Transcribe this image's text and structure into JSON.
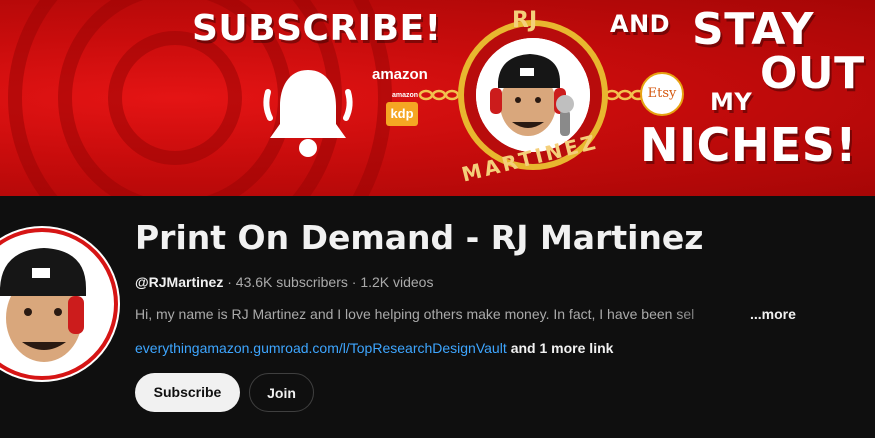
{
  "banner": {
    "headline_left": "SUBSCRIBE!",
    "headline_and": "AND",
    "headline_stay": "STAY",
    "headline_out": "OUT",
    "headline_my": "MY",
    "headline_niches": "NICHES!",
    "ring_top_label": "RJ",
    "ring_bottom_label": "MARTINEZ",
    "amazon_label": "amazon",
    "amazon_small_label": "amazon",
    "kdp_label": "kdp",
    "etsy_label": "Etsy",
    "colors": {
      "background": "#c80c0c",
      "ring": "#e8b72f",
      "text": "#ffffff"
    }
  },
  "channel": {
    "title": "Print On Demand - RJ Martinez",
    "handle": "@RJMartinez",
    "separator": " · ",
    "subscribers": "43.6K subscribers",
    "videos": "1.2K videos",
    "description": "Hi, my name is RJ Martinez and I love helping others make money. In fact, I have been sel",
    "more_label": "...more",
    "link_text": "everythingamazon.gumroad.com/l/TopResearchDesignVault",
    "more_links_label": "and 1 more link"
  },
  "actions": {
    "subscribe_label": "Subscribe",
    "join_label": "Join"
  },
  "theme": {
    "page_background": "#0f0f0f",
    "link_color": "#3ea6ff",
    "secondary_text": "#aaaaaa"
  }
}
